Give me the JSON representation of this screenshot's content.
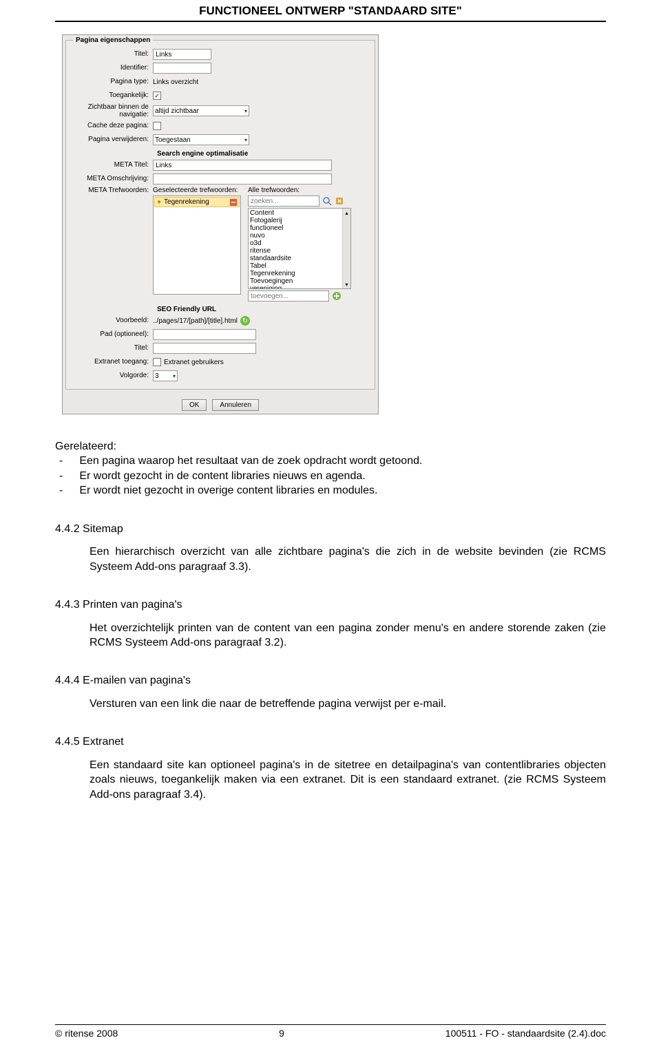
{
  "header": {
    "title": "FUNCTIONEEL ONTWERP \"STANDAARD SITE\""
  },
  "dialog": {
    "legend": "Pagina eigenschappen",
    "labels": {
      "titel": "Titel:",
      "identifier": "Identifier:",
      "ptype": "Pagina type:",
      "toeg": "Toegankelijk:",
      "zichtbaar": "Zichtbaar binnen de navigatie:",
      "cache": "Cache deze pagina:",
      "verwijderen": "Pagina verwijderen:",
      "seo_head": "Search engine optimalisatie",
      "meta_titel": "META Titel:",
      "meta_oms": "META Omschrijving:",
      "meta_tref": "META Trefwoorden:",
      "kw_sel_head": "Geselecteerde trefwoorden:",
      "kw_all_head": "Alle trefwoorden:",
      "seo_url_head": "SEO Friendly URL",
      "voorbeeld": "Voorbeeld:",
      "pad": "Pad (optioneel):",
      "titel2": "Titel:",
      "extranet": "Extranet toegang:",
      "volgorde": "Volgorde:"
    },
    "values": {
      "titel": "Links",
      "identifier": "",
      "ptype": "Links overzicht",
      "toeg_checked": "✓",
      "zichtbaar": "altijd zichtbaar",
      "cache_checked": "",
      "verwijderen": "Toegestaan",
      "meta_titel": "Links",
      "meta_oms": "",
      "sel_kw": "Tegenrekening",
      "kw_search_ph": "zoeken...",
      "kw_add_ph": "toevoegen...",
      "kw_list": [
        "Content",
        "Fotogalerij",
        "functioneel",
        "nuvo",
        "o3d",
        "ritense",
        "standaardsite",
        "Tabel",
        "Tegenrekening",
        "Toevoegingen",
        "vereniging"
      ],
      "voorbeeld_val": "../pages/17/[path]/[title].html",
      "pad_val": "",
      "titel2_val": "",
      "extranet_label": "Extranet gebruikers",
      "volgorde_val": "3"
    },
    "buttons": {
      "ok": "OK",
      "cancel": "Annuleren"
    }
  },
  "body": {
    "rel_heading": "Gerelateerd:",
    "rel_items": [
      "Een pagina waarop het resultaat van de zoek opdracht wordt getoond.",
      "Er wordt gezocht in de content libraries nieuws en agenda.",
      "Er wordt niet gezocht in overige content libraries en modules."
    ],
    "sections": [
      {
        "h": "4.4.2  Sitemap",
        "p": "Een hierarchisch overzicht van alle zichtbare pagina's die zich in de website bevinden (zie RCMS Systeem Add-ons paragraaf 3.3)."
      },
      {
        "h": "4.4.3  Printen van pagina's",
        "p": "Het overzichtelijk printen van de content van een pagina zonder menu's en andere storende zaken (zie RCMS Systeem Add-ons paragraaf 3.2)."
      },
      {
        "h": "4.4.4  E-mailen van pagina's",
        "p": "Versturen van een link die naar de betreffende pagina verwijst per e-mail."
      },
      {
        "h": "4.4.5  Extranet",
        "p": "Een standaard site kan optioneel pagina's in de sitetree en detailpagina's van contentlibraries objecten zoals nieuws, toegankelijk maken via een extranet. Dit is een standaard extranet. (zie RCMS Systeem Add-ons paragraaf 3.4)."
      }
    ]
  },
  "footer": {
    "left": "© ritense 2008",
    "center": "9",
    "right": "100511 - FO - standaardsite (2.4).doc"
  }
}
